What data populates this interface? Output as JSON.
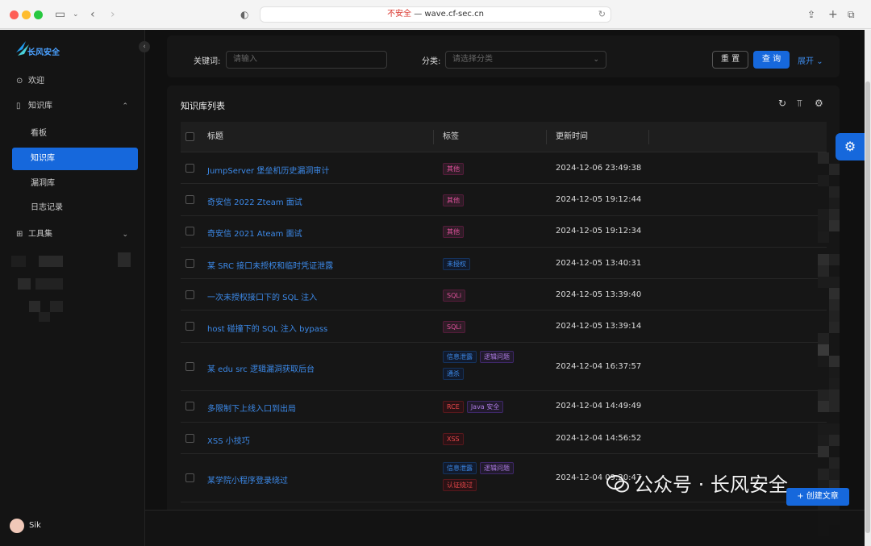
{
  "browser": {
    "url_warning": "不安全",
    "url_sep": " — ",
    "url_host": "wave.cf-sec.cn"
  },
  "logo": {
    "text": "长风安全"
  },
  "sidebar": {
    "items": [
      {
        "label": "欢迎",
        "icon": "check-circle-icon"
      },
      {
        "label": "知识库",
        "icon": "book-icon",
        "expanded": true
      },
      {
        "label": "看板"
      },
      {
        "label": "知识库",
        "active": true
      },
      {
        "label": "漏洞库"
      },
      {
        "label": "日志记录"
      },
      {
        "label": "工具集",
        "icon": "grid-icon"
      }
    ],
    "user_name": "Sik"
  },
  "search": {
    "keyword_label": "关键词:",
    "keyword_placeholder": "请输入",
    "category_label": "分类:",
    "category_placeholder": "请选择分类",
    "reset_label": "重 置",
    "query_label": "查 询",
    "expand_label": "展开"
  },
  "table": {
    "title": "知识库列表",
    "headers": {
      "title": "标题",
      "tags": "标签",
      "time": "更新时间"
    },
    "rows": [
      {
        "title": "JumpServer 堡垒机历史漏洞审计",
        "tags": [
          "其他"
        ],
        "time": "2024-12-06 23:49:38"
      },
      {
        "title": "奇安信 2022 Zteam 面试",
        "tags": [
          "其他"
        ],
        "time": "2024-12-05 19:12:44"
      },
      {
        "title": "奇安信 2021 Ateam 面试",
        "tags": [
          "其他"
        ],
        "time": "2024-12-05 19:12:34"
      },
      {
        "title": "某 SRC 接口未授权和临时凭证泄露",
        "tags": [
          "未授权"
        ],
        "time": "2024-12-05 13:40:31"
      },
      {
        "title": "一次未授权接口下的 SQL 注入",
        "tags": [
          "SQLi"
        ],
        "time": "2024-12-05 13:39:40"
      },
      {
        "title": "host 碰撞下的 SQL 注入 bypass",
        "tags": [
          "SQLi"
        ],
        "time": "2024-12-05 13:39:14"
      },
      {
        "title": "某 edu src 逻辑漏洞获取后台",
        "tags": [
          "信息泄露",
          "逻辑问题",
          "通杀"
        ],
        "time": "2024-12-04 16:37:57"
      },
      {
        "title": "多限制下上线入口到出局",
        "tags": [
          "RCE",
          "Java 安全"
        ],
        "time": "2024-12-04 14:49:49"
      },
      {
        "title": "XSS 小技巧",
        "tags": [
          "XSS"
        ],
        "time": "2024-12-04 14:56:52"
      },
      {
        "title": "某学院小程序登录绕过",
        "tags": [
          "信息泄露",
          "逻辑问题",
          "认证绕过"
        ],
        "time": "2024-12-04 09:20:47"
      }
    ]
  },
  "actions": {
    "create_label": "创建文章"
  },
  "watermark": {
    "text": "公众号 · 长风安全"
  },
  "colors": {
    "primary": "#1668dc",
    "link": "#3c89e8",
    "tag_magenta": "#e0529c",
    "tag_purple": "#ab7ae0",
    "tag_blue": "#3c89e8",
    "tag_red": "#e84749"
  }
}
